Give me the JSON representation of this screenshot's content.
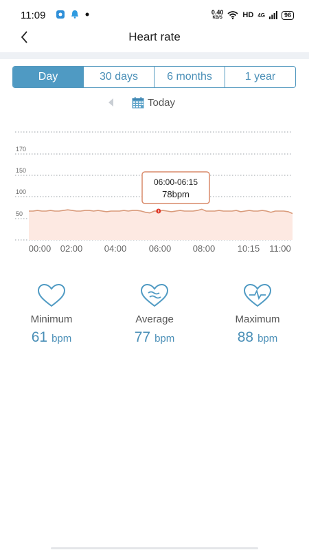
{
  "status": {
    "time": "11:09",
    "speed_value": "0.40",
    "speed_unit": "KB/S",
    "hd": "HD",
    "network": "4G",
    "battery": "96"
  },
  "header": {
    "title": "Heart rate"
  },
  "tabs": [
    {
      "label": "Day",
      "active": true
    },
    {
      "label": "30 days",
      "active": false
    },
    {
      "label": "6 months",
      "active": false
    },
    {
      "label": "1 year",
      "active": false
    }
  ],
  "date_nav": {
    "label": "Today"
  },
  "chart_data": {
    "type": "area",
    "x_tick_labels": [
      "00:00",
      "02:00",
      "04:00",
      "06:00",
      "08:00",
      "10:15",
      "11:00"
    ],
    "y_tick_labels": [
      "170",
      "150",
      "100",
      "50"
    ],
    "series": [
      {
        "values": [
          70,
          70,
          71,
          70,
          70,
          71,
          70,
          70,
          71,
          72,
          71,
          70,
          70,
          71,
          71,
          70,
          71,
          70,
          69,
          70,
          70,
          70,
          71,
          70,
          71,
          71,
          70,
          68,
          67,
          70,
          70,
          71,
          70,
          69,
          70,
          71,
          70,
          70,
          70,
          71,
          73,
          70,
          70,
          70,
          71,
          70,
          70,
          70,
          71,
          69,
          70,
          71,
          70,
          70,
          71,
          70,
          68,
          70,
          70,
          70,
          69,
          66
        ]
      }
    ],
    "highlight_index": 30,
    "tooltip": {
      "time": "06:00-06:15",
      "value": "78bpm"
    },
    "colors": {
      "line": "#d99a7a",
      "fill": "#fde9e2",
      "marker": "#e03a2a",
      "tooltip_border": "#d98a6a"
    }
  },
  "stats": [
    {
      "label": "Minimum",
      "value": "61",
      "unit": "bpm",
      "icon": "heart-outline-icon"
    },
    {
      "label": "Average",
      "value": "77",
      "unit": "bpm",
      "icon": "heart-waves-icon"
    },
    {
      "label": "Maximum",
      "value": "88",
      "unit": "bpm",
      "icon": "heart-pulse-icon"
    }
  ],
  "colors": {
    "accent": "#4f9ac3"
  }
}
